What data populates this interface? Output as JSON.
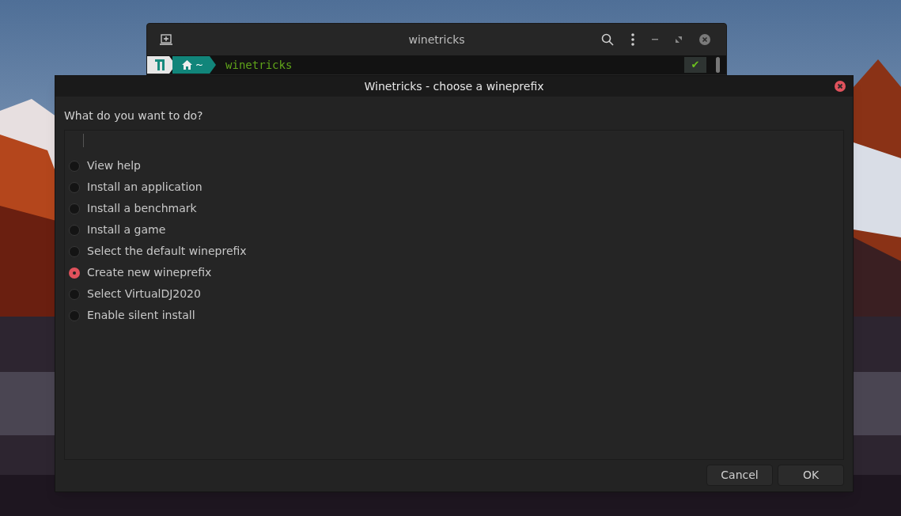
{
  "terminal": {
    "title": "winetricks",
    "prompt_path": "~",
    "command": "winetricks",
    "status": "✔"
  },
  "dialog": {
    "title": "Winetricks - choose a wineprefix",
    "question": "What do you want to do?",
    "options": [
      {
        "label": "View help",
        "selected": false
      },
      {
        "label": "Install an application",
        "selected": false
      },
      {
        "label": "Install a benchmark",
        "selected": false
      },
      {
        "label": "Install a game",
        "selected": false
      },
      {
        "label": "Select the default wineprefix",
        "selected": false
      },
      {
        "label": "Create new wineprefix",
        "selected": true
      },
      {
        "label": "Select VirtualDJ2020",
        "selected": false
      },
      {
        "label": "Enable silent install",
        "selected": false
      }
    ],
    "buttons": [
      "Cancel",
      "OK"
    ]
  }
}
